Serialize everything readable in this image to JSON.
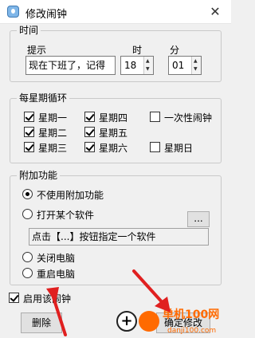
{
  "window": {
    "title": "修改闹钟",
    "close_glyph": "✕"
  },
  "time_group": {
    "legend": "时间",
    "prompt_label": "提示",
    "hour_label": "时",
    "minute_label": "分",
    "prompt_value": "现在下班了，记得",
    "hour_value": "18",
    "minute_value": "01"
  },
  "weekly_group": {
    "legend": "每星期循环",
    "days": [
      {
        "label": "星期一",
        "checked": true
      },
      {
        "label": "星期四",
        "checked": true
      },
      {
        "label": "一次性闹钟",
        "checked": false
      },
      {
        "label": "星期二",
        "checked": true
      },
      {
        "label": "星期五",
        "checked": true
      },
      {
        "label": "星期三",
        "checked": true
      },
      {
        "label": "星期六",
        "checked": true
      },
      {
        "label": "星期日",
        "checked": false
      }
    ]
  },
  "extra_group": {
    "legend": "附加功能",
    "options": [
      {
        "label": "不使用附加功能",
        "selected": true
      },
      {
        "label": "打开某个软件",
        "selected": false
      },
      {
        "label": "关闭电脑",
        "selected": false
      },
      {
        "label": "重启电脑",
        "selected": false
      }
    ],
    "browse_label": "...",
    "software_hint": "点击【...】按钮指定一个软件"
  },
  "enable": {
    "label": "启用该闹钟",
    "checked": true
  },
  "buttons": {
    "delete": "删除",
    "confirm": "确定修改"
  },
  "watermark": {
    "text": "单机100网",
    "url": "danji100.com"
  },
  "colors": {
    "arrow": "#e02020",
    "watermark": "#ff6a00"
  }
}
